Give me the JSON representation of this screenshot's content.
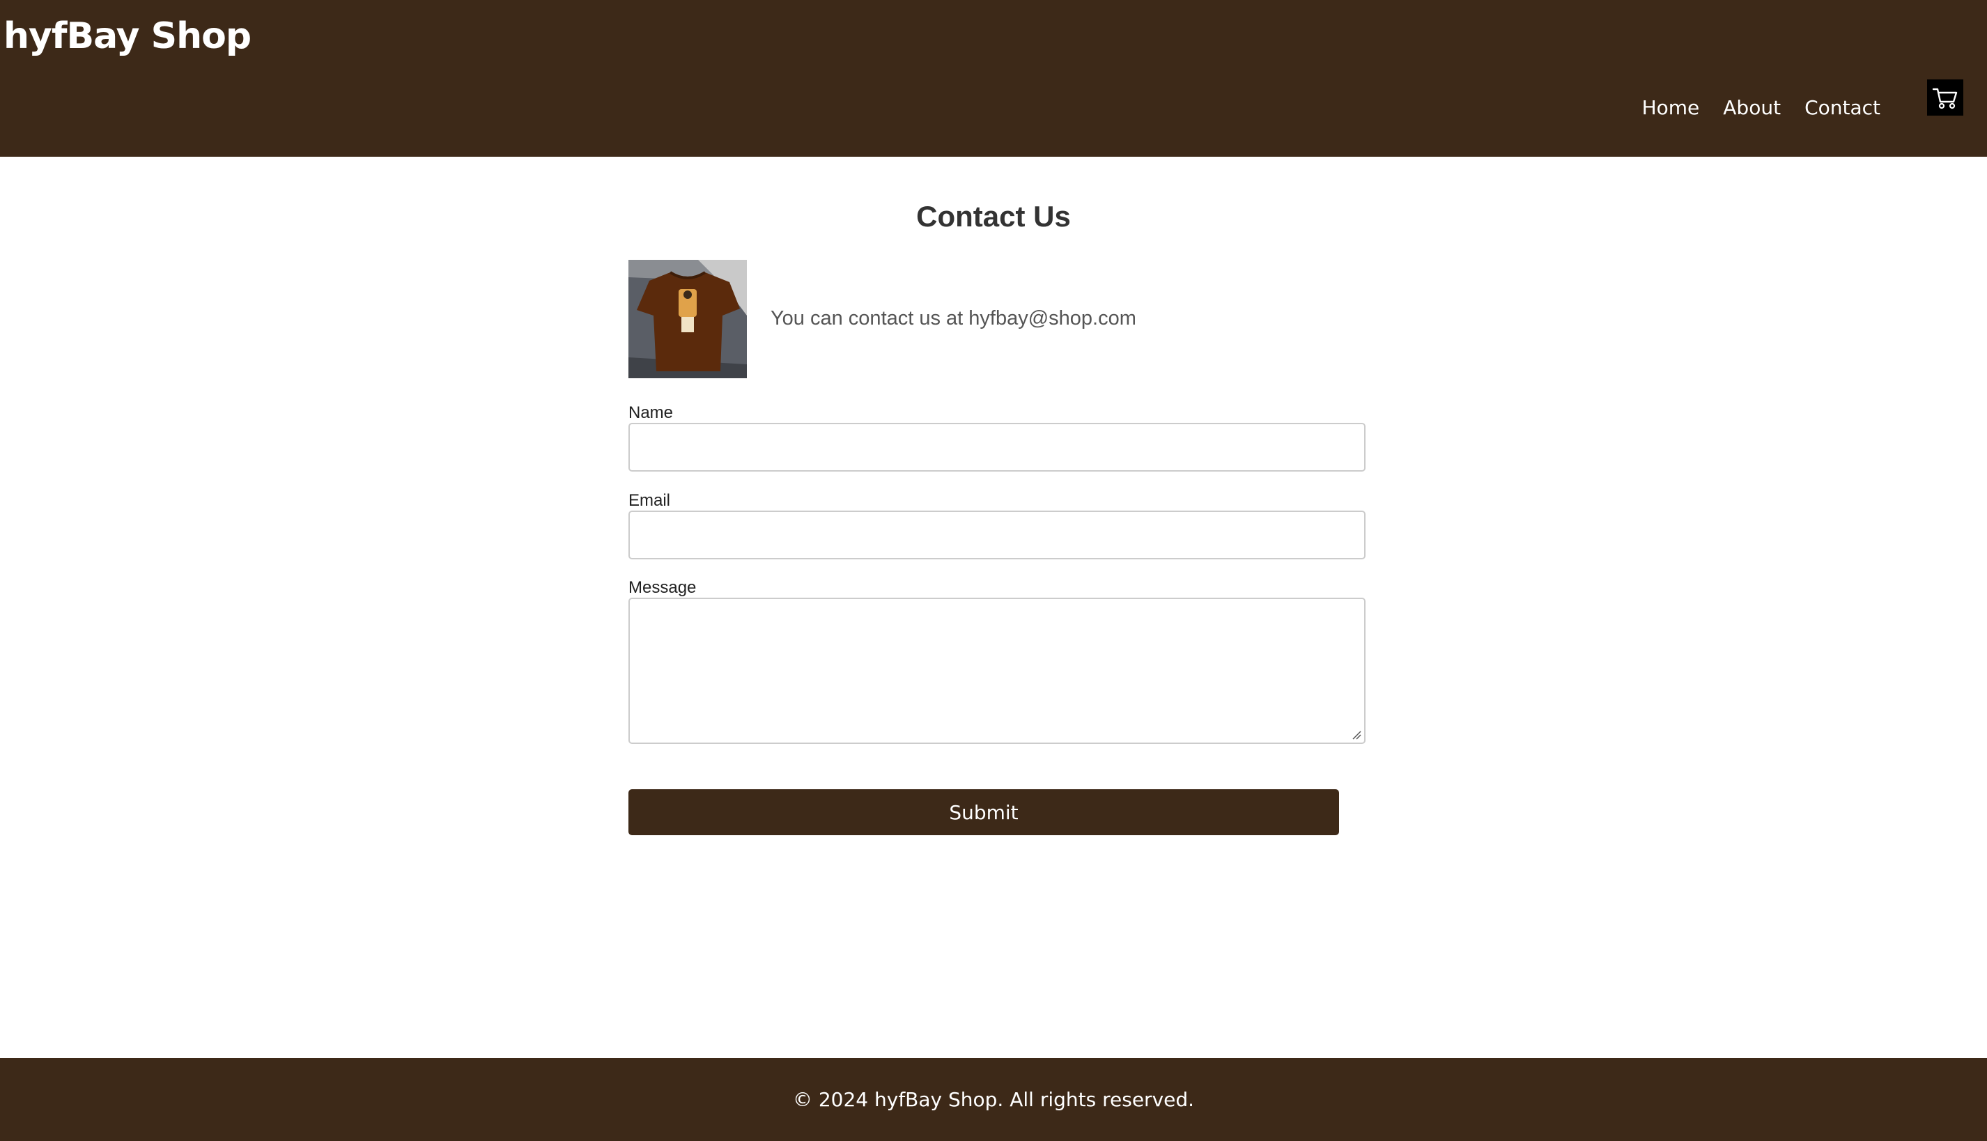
{
  "header": {
    "site_title": "hyfBay Shop",
    "nav": [
      {
        "label": "Home"
      },
      {
        "label": "About"
      },
      {
        "label": "Contact"
      }
    ],
    "cart_icon": "shopping-cart-icon"
  },
  "main": {
    "title": "Contact Us",
    "contact_text": "You can contact us at hyfbay@shop.com",
    "image": "brown-tshirt-thumbnail",
    "form": {
      "name_label": "Name",
      "name_value": "",
      "email_label": "Email",
      "email_value": "",
      "message_label": "Message",
      "message_value": "",
      "submit_label": "Submit"
    }
  },
  "footer": {
    "copyright": "© 2024 hyfBay Shop. All rights reserved."
  },
  "colors": {
    "brand": "#3d2918",
    "text_dark": "#333333",
    "text_muted": "#555555"
  }
}
